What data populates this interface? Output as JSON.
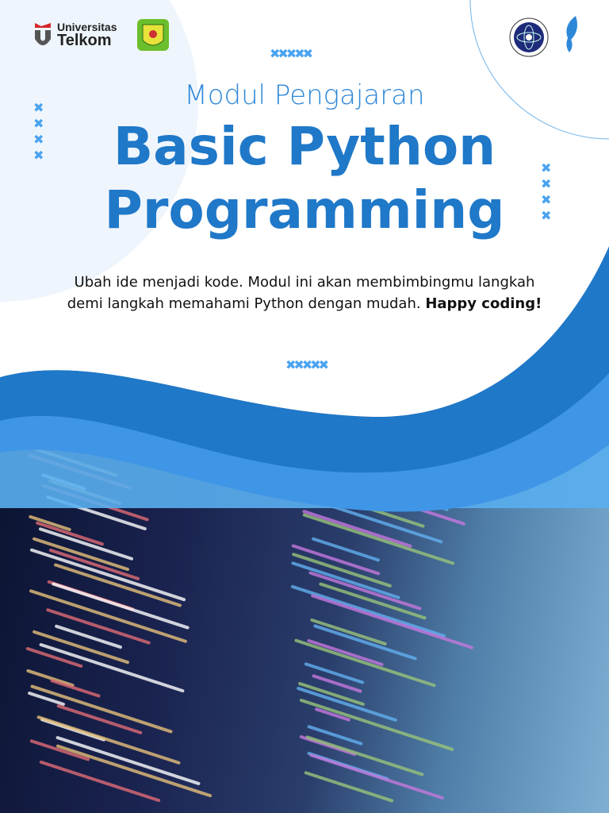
{
  "logos": {
    "university_line1": "Universitas",
    "university_line2": "Telkom"
  },
  "cover": {
    "subtitle": "Modul Pengajaran",
    "title_line1": "Basic Python",
    "title_line2": "Programming",
    "description": "Ubah ide menjadi kode. Modul ini akan membimbingmu langkah demi langkah memahami Python dengan mudah.",
    "description_bold": "Happy coding!"
  },
  "colors": {
    "primary": "#1f78c8",
    "accent": "#4aa3f0",
    "dark": "#0b1330"
  }
}
